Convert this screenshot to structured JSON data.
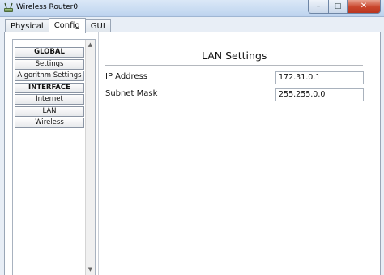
{
  "window": {
    "title": "Wireless Router0",
    "minimize_glyph": "–",
    "maximize_glyph": "□",
    "close_glyph": "✕"
  },
  "tabs": [
    {
      "label": "Physical",
      "active": false
    },
    {
      "label": "Config",
      "active": true
    },
    {
      "label": "GUI",
      "active": false
    }
  ],
  "sidebar": {
    "global_header": "GLOBAL",
    "settings": "Settings",
    "algorithm_settings": "Algorithm Settings",
    "interface_header": "INTERFACE",
    "internet": "Internet",
    "lan": "LAN",
    "wireless": "Wireless"
  },
  "main": {
    "section_title": "LAN Settings",
    "ip_label": "IP Address",
    "ip_value": "172.31.0.1",
    "mask_label": "Subnet Mask",
    "mask_value": "255.255.0.0"
  },
  "icons": {
    "app": "router-icon",
    "scroll_up": "scroll-up-arrow-icon",
    "scroll_down": "scroll-down-arrow-icon"
  }
}
